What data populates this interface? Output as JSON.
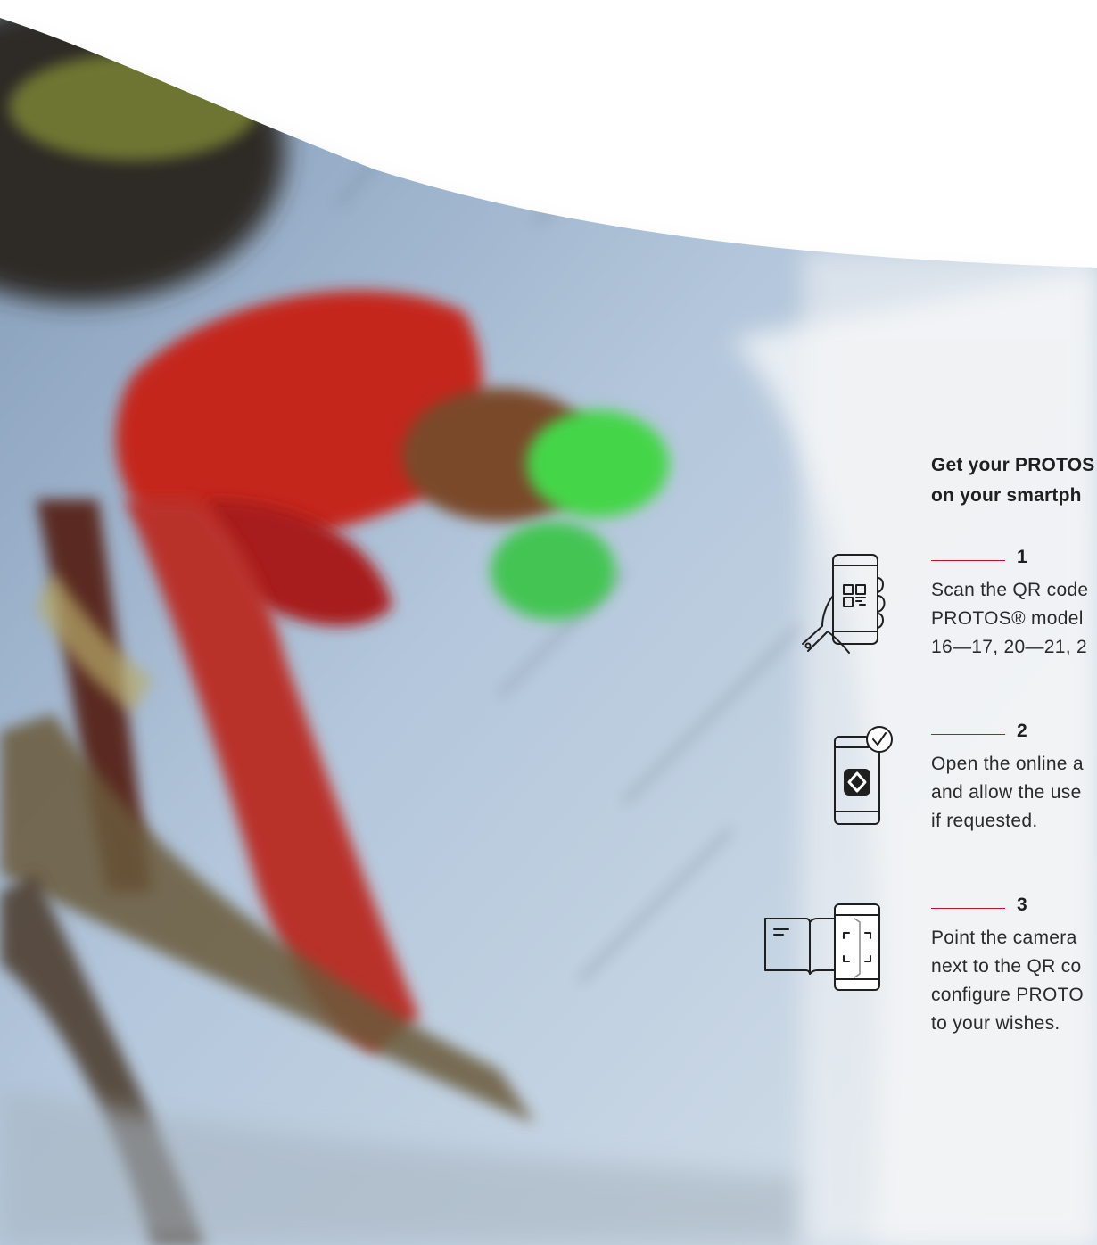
{
  "panel": {
    "headline_line1": "Get your PROTOS",
    "headline_line2": "on your smartph"
  },
  "steps": [
    {
      "number": "1",
      "text_lines": [
        "Scan the QR code",
        "PROTOS® model",
        "16—17, 20—21, 2"
      ],
      "icon": "phone-scan-qr-icon"
    },
    {
      "number": "2",
      "text_lines": [
        "Open the online a",
        "and allow the use",
        "if requested."
      ],
      "icon": "phone-app-check-icon"
    },
    {
      "number": "3",
      "text_lines": [
        "Point the camera",
        "next to the QR co",
        "configure PROTO",
        "to your wishes."
      ],
      "icon": "book-phone-camera-icon"
    }
  ],
  "colors": {
    "accent_red": "#c8102e",
    "text": "#1f1f1f"
  }
}
